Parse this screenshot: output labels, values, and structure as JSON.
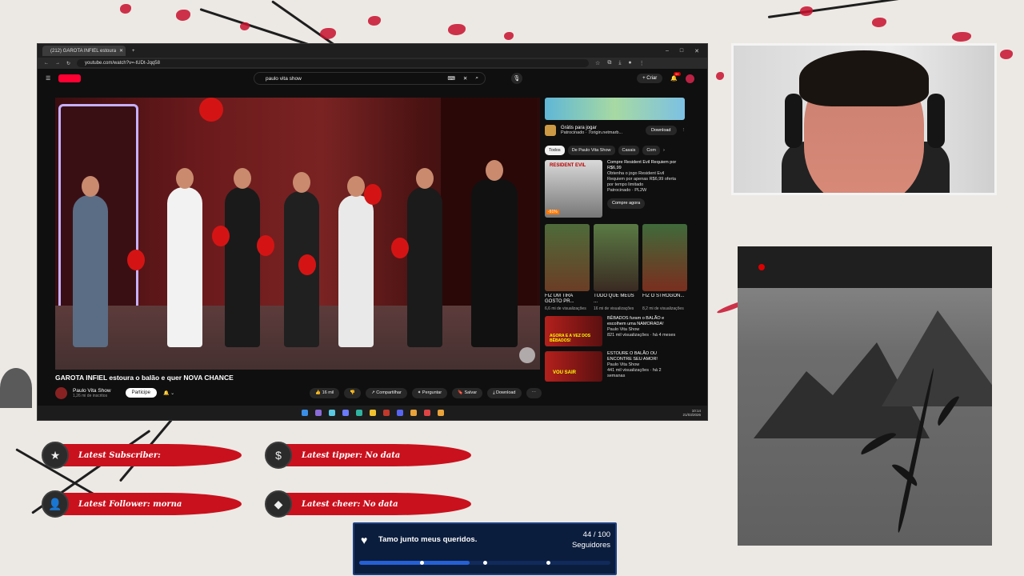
{
  "browser": {
    "tab_title": "(212) GAROTA INFIEL estoura",
    "url": "youtube.com/watch?v=-tUDt-Jqq58",
    "search_query": "paulo vita show",
    "create_label": "Criar",
    "notif_count": "9+"
  },
  "video": {
    "title": "GAROTA INFIEL estoura o balão e quer NOVA CHANCE",
    "channel": "Paulo Vita Show",
    "subscribers": "1,26 mi de inscritos",
    "join_label": "Participe",
    "likes": "16 mil",
    "share_label": "Compartilhar",
    "ask_label": "Perguntar",
    "save_label": "Salvar",
    "download_label": "Download"
  },
  "sidebar": {
    "ad_title": "Grátis para jogar",
    "ad_sponsor": "Patrocinado · 7origin.netmarb...",
    "ad_button": "Download",
    "chips": [
      "Todos",
      "De Paulo Vita Show",
      "Casais",
      "Com"
    ],
    "promo_thumb_title": "RESIDENT EVIL",
    "promo_discount": "-91%",
    "promo_title": "Compre Resident Evil Requiem por R$6,99",
    "promo_desc": "Obtenha o jogo Resident Evil Requiem por apenas R$6,99 oferta por tempo limitado",
    "promo_sponsor": "Patrocinado · PL2W",
    "promo_button": "Compre agora",
    "shorts": [
      {
        "title": "FIZ UM TIRA GOSTO PR...",
        "views": "6,6 mi de visualizações"
      },
      {
        "title": "TUDO QUE MEUS ...",
        "views": "16 mi de visualizações"
      },
      {
        "title": "FIZ O STROGON...",
        "views": "8,2 mi de visualizações"
      }
    ],
    "recs": [
      {
        "title": "BÊBADOS furam o BALÃO e escolhem uma NAMORADA!",
        "channel": "Paulo Vita Show",
        "meta": "821 mil visualizações · há 4 meses",
        "thumb_text": "AGORA E A VEZ DOS BÊBADOS!"
      },
      {
        "title": "ESTOURE O BALÃO OU ENCONTRE SEU AMOR!",
        "channel": "Paulo Vita Show",
        "meta": "441 mil visualizações · há 2 semanas",
        "thumb_text": "VOU SAIR"
      }
    ]
  },
  "taskbar": {
    "time": "10:14",
    "date": "21/03/2026"
  },
  "alerts": {
    "subscriber": "Latest Subscriber:",
    "tipper": "Latest tipper: No data",
    "follower": "Latest Follower: morna",
    "cheer": "Latest cheer: No data"
  },
  "goal": {
    "label": "Tamo junto meus queridos.",
    "count": "44 / 100",
    "unit": "Seguidores",
    "progress": 0.44
  }
}
